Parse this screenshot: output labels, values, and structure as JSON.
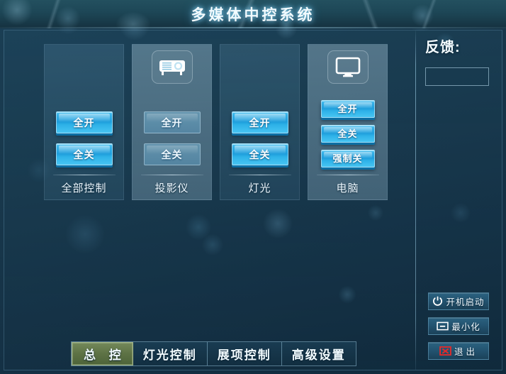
{
  "window": {
    "title": "多媒体中控系统"
  },
  "panels": [
    {
      "name": "全部控制",
      "icon": "none",
      "style": "dark",
      "buttons": [
        {
          "label": "全开",
          "style": "glossy",
          "size": "large"
        },
        {
          "label": "全关",
          "style": "glossy",
          "size": "large"
        }
      ]
    },
    {
      "name": "投影仪",
      "icon": "projector-icon",
      "style": "light",
      "buttons": [
        {
          "label": "全开",
          "style": "flat",
          "size": "large"
        },
        {
          "label": "全关",
          "style": "flat",
          "size": "large"
        }
      ]
    },
    {
      "name": "灯光",
      "icon": "none",
      "style": "dark",
      "buttons": [
        {
          "label": "全开",
          "style": "glossy",
          "size": "large"
        },
        {
          "label": "全关",
          "style": "glossy",
          "size": "large"
        }
      ]
    },
    {
      "name": "电脑",
      "icon": "monitor-icon",
      "style": "light",
      "buttons": [
        {
          "label": "全开",
          "style": "glossy",
          "size": "small"
        },
        {
          "label": "全关",
          "style": "glossy",
          "size": "small"
        },
        {
          "label": "强制关",
          "style": "glossy",
          "size": "small"
        }
      ]
    }
  ],
  "feedback": {
    "label": "反馈:",
    "value": "",
    "placeholder": ""
  },
  "system_buttons": [
    {
      "label": "开机启动",
      "icon": "power-icon"
    },
    {
      "label": "最小化",
      "icon": "minimize-icon"
    },
    {
      "label": "退出",
      "icon": "close-icon"
    }
  ],
  "tabs": [
    {
      "label": "总  控",
      "active": true
    },
    {
      "label": "灯光控制",
      "active": false
    },
    {
      "label": "展项控制",
      "active": false
    },
    {
      "label": "高级设置",
      "active": false
    }
  ],
  "colors": {
    "accent_button": "#2eb2e8",
    "button_shadow": "#0d6fa4",
    "active_tab": "#5d7245",
    "exit_red": "#e02b2b",
    "background": "#163244"
  }
}
